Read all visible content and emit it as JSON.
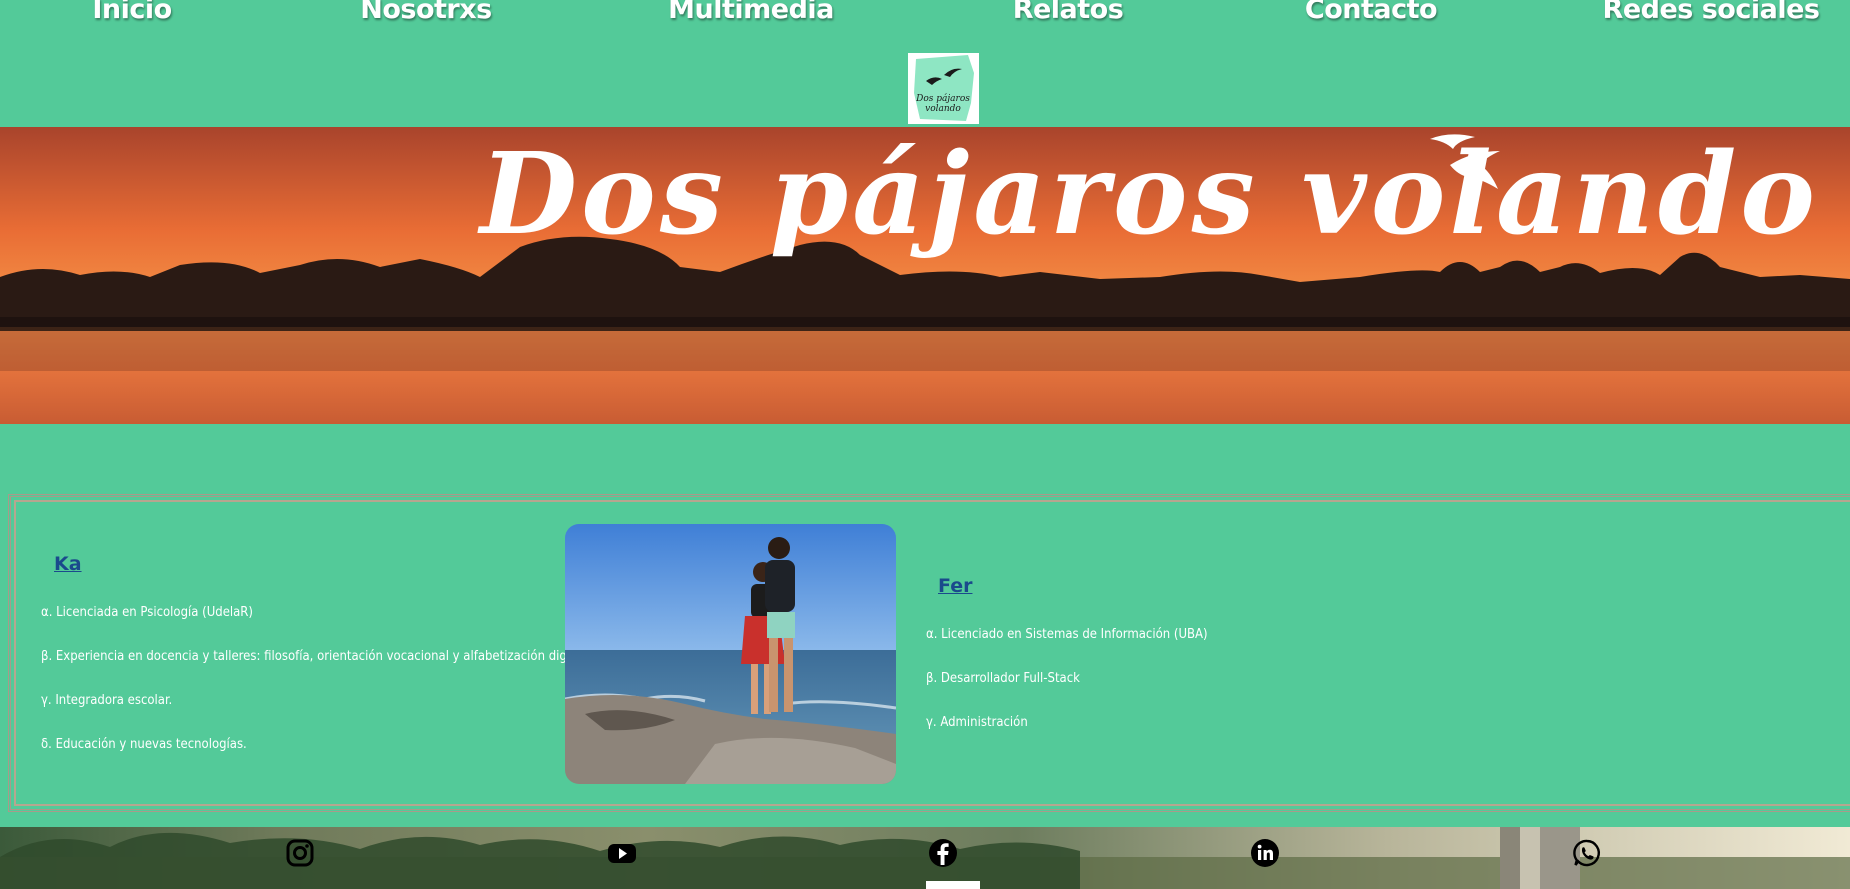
{
  "nav": {
    "items": [
      {
        "label": "Inicio"
      },
      {
        "label": "Nosotrxs"
      },
      {
        "label": "Multimedia"
      },
      {
        "label": "Relatos"
      },
      {
        "label": "Contacto"
      },
      {
        "label": "Redes sociales"
      }
    ]
  },
  "logo": {
    "text": "Dos pájaros volando"
  },
  "banner": {
    "title": "Dos pájaros volando"
  },
  "people": [
    {
      "name": "Ka",
      "items": [
        "α. Licenciada en Psicología (UdelaR)",
        "β. Experiencia en docencia y talleres: filosofía, orientación vocacional y alfabetización digital.",
        "γ. Integradora escolar.",
        "δ. Educación y nuevas tecnologías."
      ]
    },
    {
      "name": "Fer",
      "items": [
        "α. Licenciado en Sistemas de Información (UBA)",
        "β. Desarrollador Full-Stack",
        "γ. Administración"
      ]
    }
  ],
  "footer": {
    "socials": [
      "instagram-icon",
      "youtube-icon",
      "facebook-icon",
      "linkedin-icon",
      "whatsapp-icon"
    ]
  },
  "colors": {
    "background": "#53ca99",
    "name_link": "#1a4a8c",
    "text": "#ffffff"
  }
}
